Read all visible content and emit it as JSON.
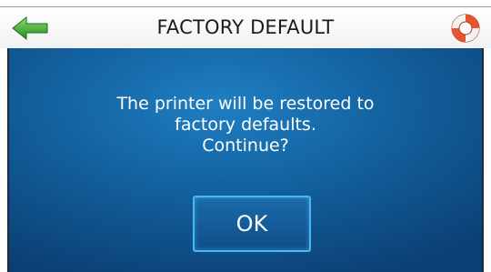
{
  "header": {
    "title": "FACTORY DEFAULT",
    "back_icon": "back-arrow-icon",
    "help_icon": "lifebuoy-icon"
  },
  "dialog": {
    "message_lines": [
      "The printer will be restored to",
      "factory defaults.",
      "Continue?"
    ],
    "ok_label": "OK"
  },
  "colors": {
    "accent_green": "#2fa82f",
    "button_border": "#49b8f0",
    "background_blue": "#13619f",
    "lifebuoy_orange": "#e4572e"
  }
}
